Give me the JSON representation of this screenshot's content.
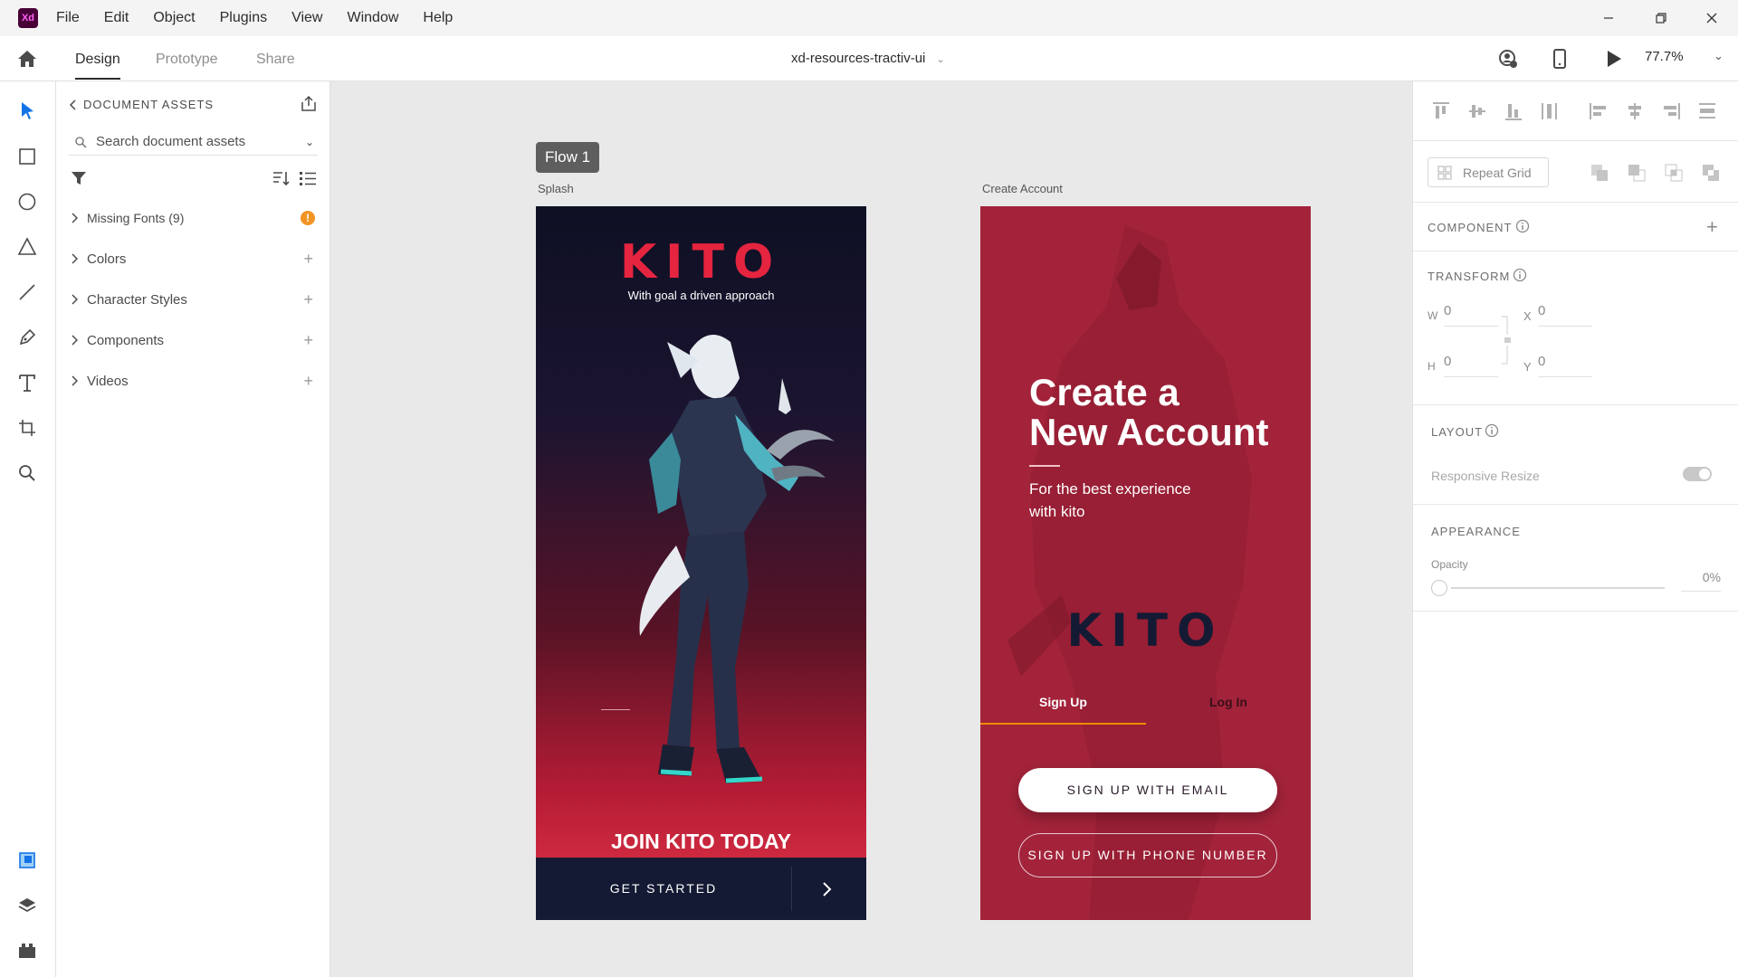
{
  "app": {
    "logo": "Xd"
  },
  "menu": [
    "File",
    "Edit",
    "Object",
    "Plugins",
    "View",
    "Window",
    "Help"
  ],
  "tabs": {
    "design": "Design",
    "prototype": "Prototype",
    "share": "Share"
  },
  "document": {
    "title": "xd-resources-tractiv-ui"
  },
  "zoom": "77.7%",
  "assets": {
    "header": "DOCUMENT ASSETS",
    "search_placeholder": "Search document assets",
    "missing_fonts": "Missing Fonts (9)",
    "sections": [
      "Colors",
      "Character Styles",
      "Components",
      "Videos"
    ]
  },
  "canvas": {
    "flow_label": "Flow 1",
    "artboards": {
      "splash": "Splash",
      "create": "Create Account"
    }
  },
  "splash": {
    "logo": "KITO",
    "tagline": "With goal a driven approach",
    "join": "JOIN  KITO TODAY",
    "cta": "GET STARTED"
  },
  "create": {
    "title_line1": "Create a",
    "title_line2": "New Account",
    "subtitle_line1": "For the best experience",
    "subtitle_line2": "with kito",
    "logo": "KITO",
    "tab_signup": "Sign Up",
    "tab_login": "Log In",
    "btn_email": "SIGN UP WITH EMAIL",
    "btn_phone": "SIGN UP WITH PHONE NUMBER"
  },
  "properties": {
    "repeat_grid": "Repeat Grid",
    "component": "COMPONENT",
    "transform": "TRANSFORM",
    "w_label": "W",
    "w_value": "0",
    "h_label": "H",
    "h_value": "0",
    "x_label": "X",
    "x_value": "0",
    "y_label": "Y",
    "y_value": "0",
    "layout": "LAYOUT",
    "responsive_resize": "Responsive Resize",
    "appearance": "APPEARANCE",
    "opacity_label": "Opacity",
    "opacity_value": "0%"
  },
  "colors": {
    "brand_red": "#e5243f",
    "navy": "#141a33",
    "create_bg": "#a3233a",
    "accent_orange": "#f08c00",
    "selection_blue": "#1473e6"
  }
}
